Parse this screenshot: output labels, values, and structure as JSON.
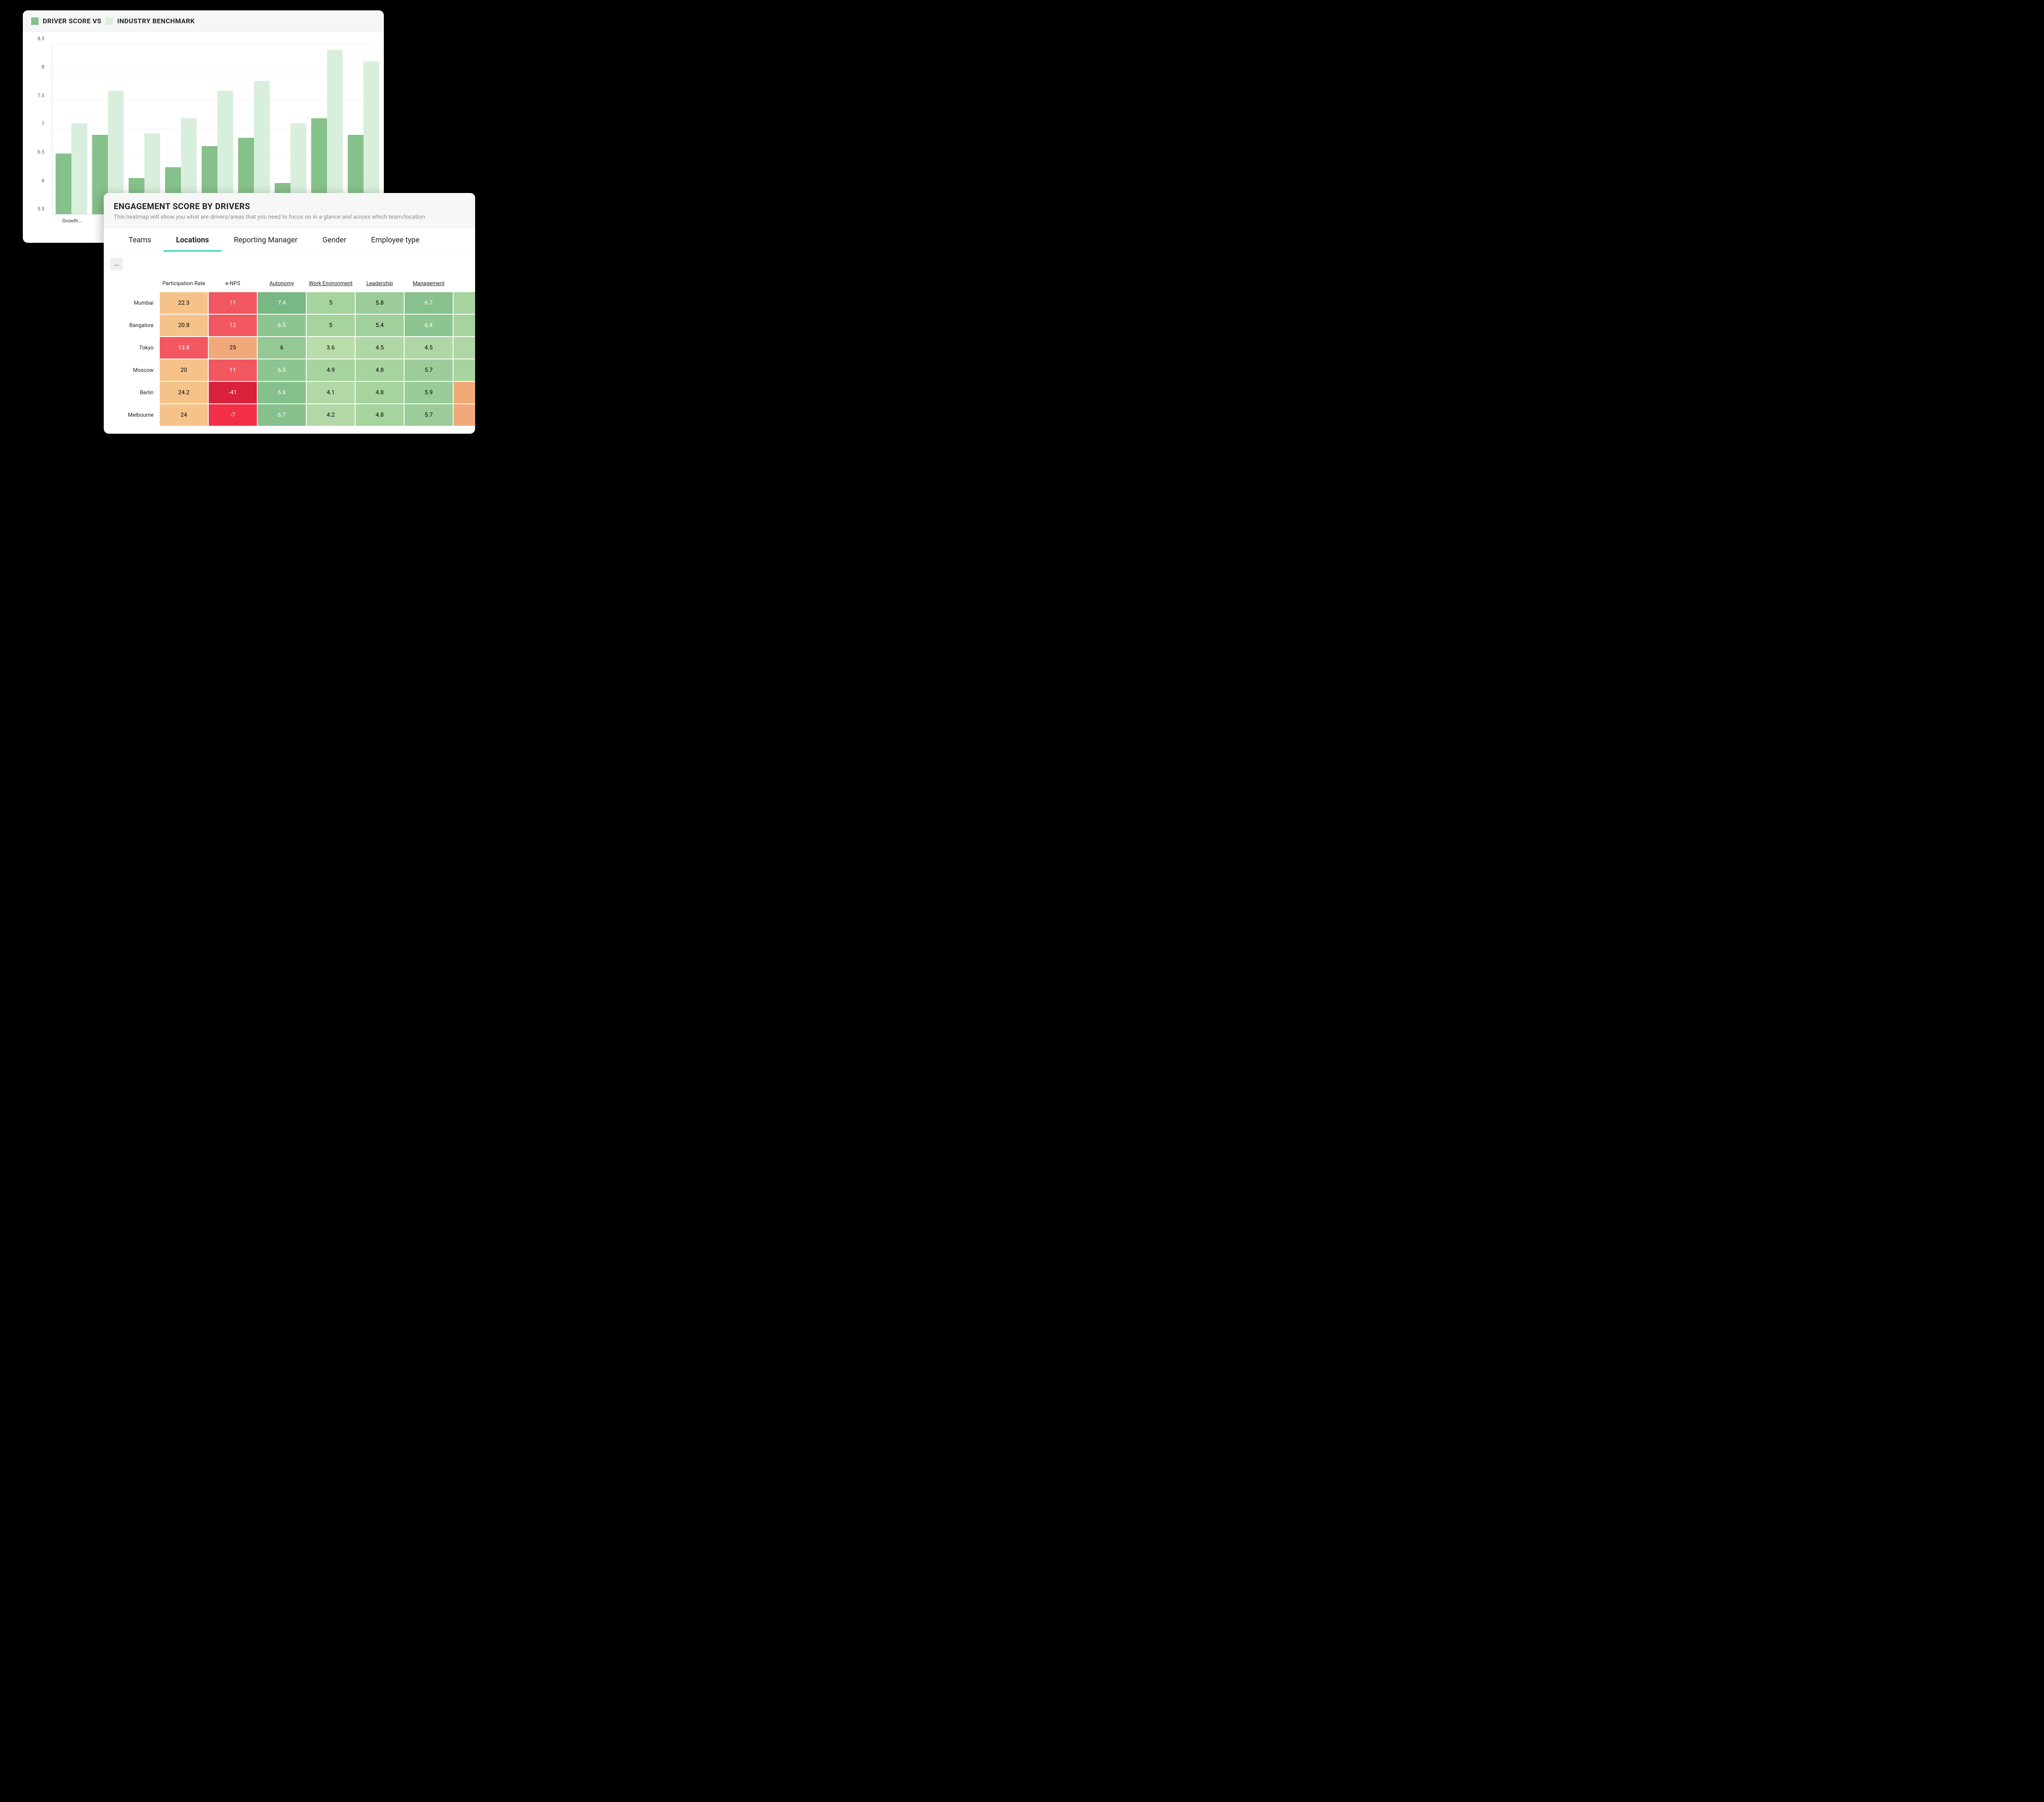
{
  "bar_card": {
    "legend": {
      "series1": "DRIVER SCORE VS",
      "series2": "INDUSTRY BENCHMARK"
    },
    "x_labels": [
      "Growth...",
      "",
      "",
      "",
      "",
      "",
      "",
      "",
      ""
    ]
  },
  "heat_card": {
    "title": "ENGAGEMENT SCORE BY DRIVERS",
    "subtitle": "This heatmap will show you what are drivers/areas that you need to focus on in a glance and across which team/location",
    "tabs": [
      "Teams",
      "Locations",
      "Reporting Manager",
      "Gender",
      "Employee type"
    ],
    "active_tab": 1,
    "more": "...",
    "columns": [
      "Participation Rate",
      "e-NPS",
      "Autonomy",
      "Work Environment",
      "Leadership",
      "Management",
      ""
    ],
    "col_underline": [
      false,
      false,
      true,
      true,
      true,
      true,
      false
    ],
    "rows": [
      "Mumbai",
      "Bangalore",
      "Tokyo",
      "Moscow",
      "Berlin",
      "Melbourne"
    ]
  },
  "chart_data": [
    {
      "type": "bar",
      "title": "DRIVER SCORE VS INDUSTRY BENCHMARK",
      "ylim": [
        5.5,
        8.5
      ],
      "yticks": [
        5.5,
        6,
        6.5,
        7,
        7.5,
        8,
        8.5
      ],
      "categories": [
        "Growth...",
        "",
        "",
        "",
        "",
        "",
        "",
        "",
        ""
      ],
      "series": [
        {
          "name": "Driver Score",
          "color": "#86c08a",
          "values": [
            6.57,
            6.9,
            6.14,
            6.33,
            6.7,
            6.85,
            6.05,
            7.19,
            6.9
          ]
        },
        {
          "name": "Industry Benchmark",
          "color": "#d9efdd",
          "values": [
            7.1,
            7.67,
            6.93,
            7.19,
            7.67,
            7.85,
            7.1,
            8.4,
            8.19
          ]
        }
      ]
    },
    {
      "type": "heatmap",
      "title": "ENGAGEMENT SCORE BY DRIVERS",
      "xlabel": "",
      "ylabel": "",
      "row_labels": [
        "Mumbai",
        "Bangalore",
        "Tokyo",
        "Moscow",
        "Berlin",
        "Melbourne"
      ],
      "col_labels": [
        "Participation Rate",
        "e-NPS",
        "Autonomy",
        "Work Environment",
        "Leadership",
        "Management"
      ],
      "values": [
        [
          22.3,
          11,
          7.4,
          5,
          5.8,
          6.7
        ],
        [
          20.8,
          12,
          6.5,
          5,
          5.4,
          6.4
        ],
        [
          13.8,
          25,
          6,
          3.6,
          4.5,
          4.5
        ],
        [
          20,
          11,
          6.5,
          4.9,
          4.8,
          5.7
        ],
        [
          24.2,
          -41,
          6.8,
          4.1,
          4.8,
          5.9
        ],
        [
          24,
          -7,
          6.7,
          4.2,
          4.8,
          5.7
        ]
      ],
      "cell_colors": [
        [
          "#f5c38a",
          "#f2565f",
          "#77b884",
          "#a6d39e",
          "#9bcc99",
          "#88c18d",
          "#a6d39e"
        ],
        [
          "#f5c38a",
          "#f2565f",
          "#8cc591",
          "#a6d39e",
          "#a1d09c",
          "#8cc591",
          "#a6d39e"
        ],
        [
          "#f2565f",
          "#f2a97a",
          "#94c995",
          "#b9dcab",
          "#afd6a5",
          "#afd6a5",
          "#afd6a5"
        ],
        [
          "#f5c38a",
          "#f2565f",
          "#8cc591",
          "#a6d39e",
          "#a6d39e",
          "#9bcc99",
          "#a6d39e"
        ],
        [
          "#f5c38a",
          "#d9213b",
          "#84c08c",
          "#b2d8a7",
          "#a6d39e",
          "#98cb98",
          "#f2a97a"
        ],
        [
          "#f5c38a",
          "#f22f47",
          "#86c18d",
          "#b2d8a7",
          "#a6d39e",
          "#9bcc99",
          "#f2a97a"
        ]
      ],
      "cell_dark": [
        [
          false,
          true,
          true,
          false,
          false,
          true,
          false
        ],
        [
          false,
          true,
          true,
          false,
          false,
          true,
          false
        ],
        [
          true,
          false,
          false,
          false,
          false,
          false,
          false
        ],
        [
          false,
          true,
          true,
          false,
          false,
          false,
          false
        ],
        [
          false,
          true,
          true,
          false,
          false,
          false,
          false
        ],
        [
          false,
          true,
          true,
          false,
          false,
          false,
          false
        ]
      ]
    }
  ]
}
